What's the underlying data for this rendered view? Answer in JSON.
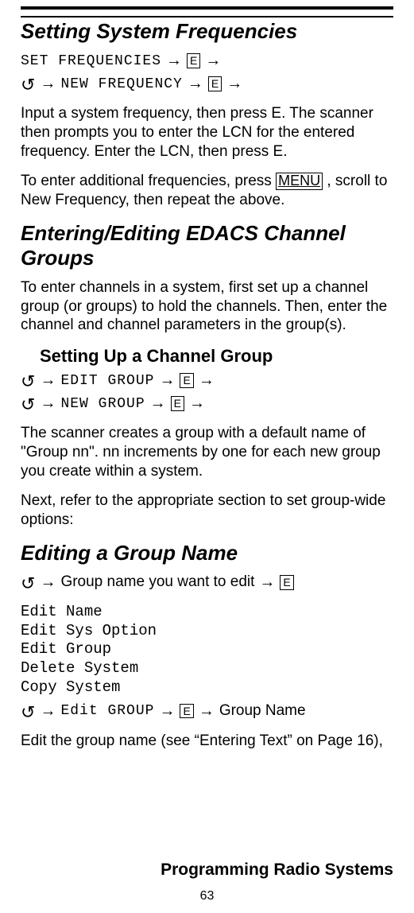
{
  "h1_a": "Setting System Frequencies",
  "seq1a": {
    "t1": "SET FREQUENCIES",
    "key1": "E"
  },
  "seq1b": {
    "t1": "NEW FREQUENCY",
    "key1": "E"
  },
  "p1": "Input a system frequency, then press E. The scanner then prompts you to enter the LCN for the entered frequency. Enter the LCN, then press E.",
  "p2a": "To enter additional frequencies, press ",
  "menu_key": "MENU",
  "p2b": ", scroll to New Frequency, then repeat the above.",
  "h1_b": "Entering/Editing EDACS Channel Groups",
  "p3": "To enter channels in a system, first set up a channel group (or groups) to hold the channels. Then, enter the channel and channel parameters in the group(s).",
  "h2_a": "Setting Up a Channel Group",
  "seq2a": {
    "t1": "EDIT GROUP",
    "key1": "E"
  },
  "seq2b": {
    "t1": "NEW GROUP",
    "key1": "E"
  },
  "p4": "The scanner creates a group with a default name of \"Group nn\". nn increments by one for each new group you create within a system.",
  "p5": "Next, refer to the appropriate section to set group-wide options:",
  "h1_c": "Editing a Group Name",
  "seq3": {
    "t1": "Group name you want to edit",
    "key1": "E"
  },
  "menu_items": [
    "Edit Name",
    "Edit Sys Option",
    "Edit Group",
    "Delete System",
    "Copy System"
  ],
  "seq4": {
    "t1": "Edit GROUP",
    "key1": "E",
    "t2": "Group Name"
  },
  "p6": "Edit the group name (see “Entering Text” on Page 16),",
  "footer": "Programming Radio Systems",
  "page": "63"
}
